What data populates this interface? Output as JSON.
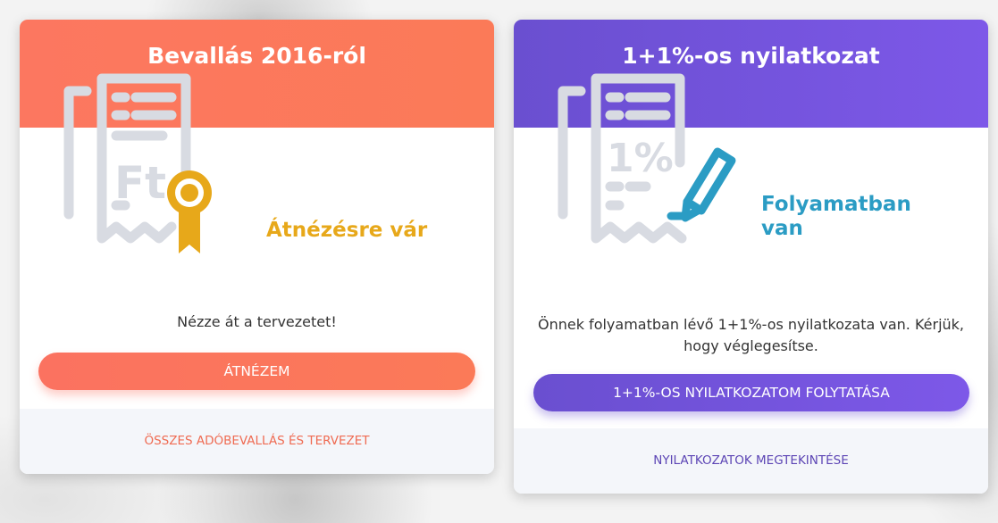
{
  "cards": [
    {
      "title": "Bevallás 2016-ról",
      "status": "Átnézésre vár",
      "description": "Nézze át a tervezetet!",
      "button_label": "ÁTNÉZEM",
      "footer_link": "ÖSSZES ADÓBEVALLÁS ÉS TERVEZET",
      "illustration_text": "Ft",
      "accent_color": "#fb7760",
      "status_color": "#e7a81a"
    },
    {
      "title": "1+1%-os nyilatkozat",
      "status_line1": "Folyamatban",
      "status_line2": "van",
      "description": "Önnek folyamatban lévő 1+1%-os nyilatkozata van. Kérjük, hogy véglegesítse.",
      "button_label": "1+1%-OS NYILATKOZATOM FOLYTATÁSA",
      "footer_link": "NYILATKOZATOK MEGTEKINTÉSE",
      "illustration_text": "1%",
      "accent_color": "#6a4fd0",
      "status_color": "#2b9cc4"
    }
  ]
}
